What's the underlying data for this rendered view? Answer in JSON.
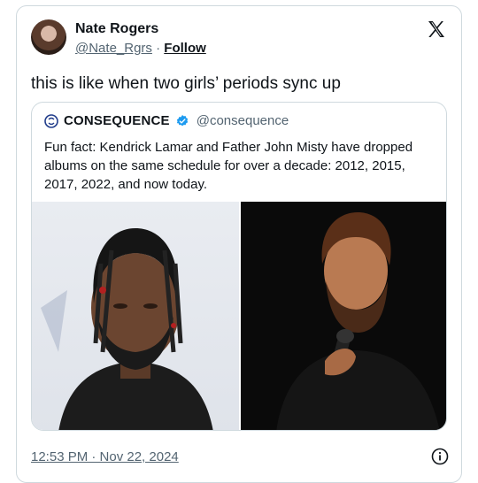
{
  "author": {
    "name": "Nate Rogers",
    "handle": "@Nate_Rgrs",
    "separator": "·",
    "follow_label": "Follow"
  },
  "tweet": {
    "text": "this is like when two girls’ periods sync up",
    "timestamp": "12:53 PM · Nov 22, 2024"
  },
  "quoted": {
    "name": "CONSEQUENCE",
    "handle": "@consequence",
    "text": "Fun fact: Kendrick Lamar and Father John Misty have dropped albums on the same schedule for over a decade: 2012, 2015, 2017, 2022, and now today.",
    "images": [
      "photo-kendrick-lamar",
      "photo-father-john-misty"
    ]
  },
  "icons": {
    "platform": "x-logo-icon",
    "verified": "verified-badge-icon",
    "info": "info-icon"
  },
  "colors": {
    "verified_blue": "#1d9bf0",
    "secondary_text": "#536471",
    "border": "#cfd9de"
  }
}
